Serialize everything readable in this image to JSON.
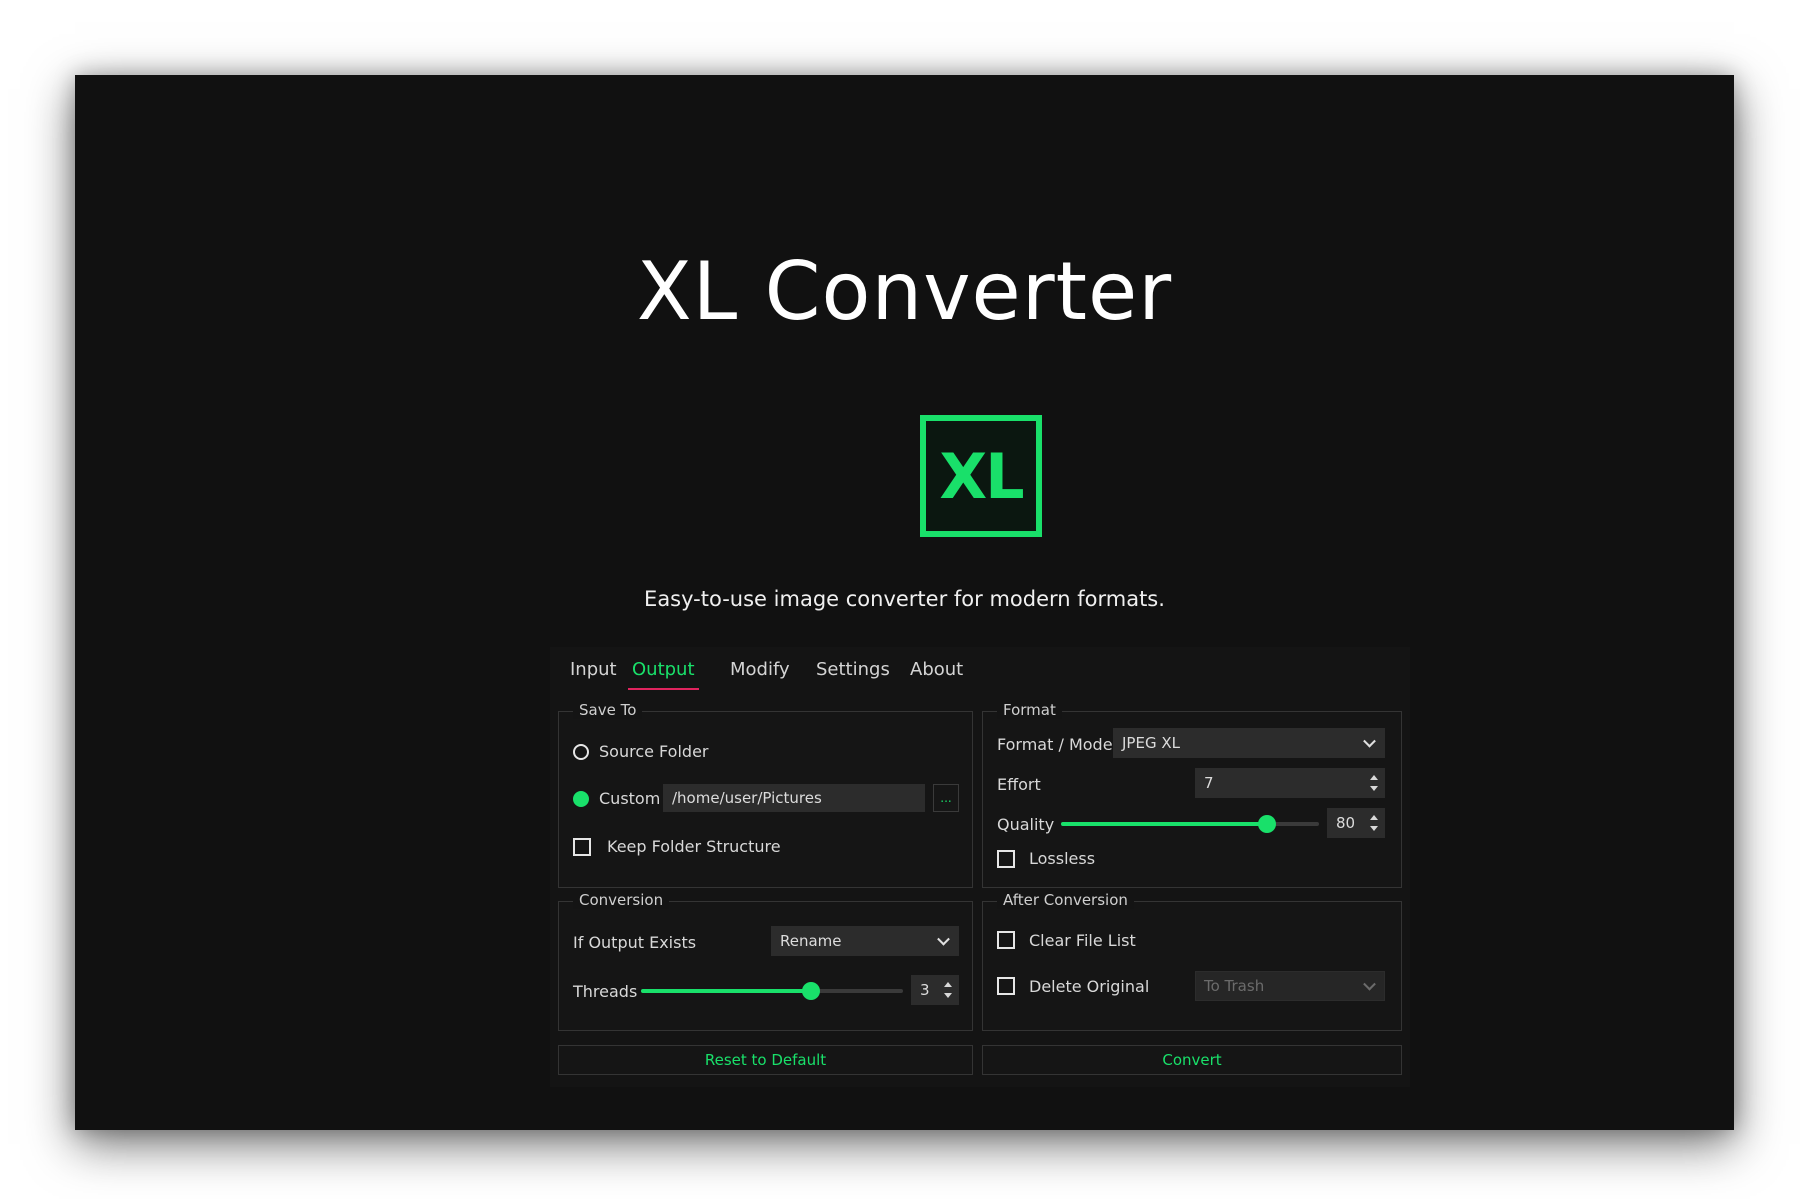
{
  "hero": {
    "title": "XL Converter",
    "logo_text": "XL",
    "tagline": "Easy-to-use image converter for modern formats."
  },
  "tabs": [
    {
      "label": "Input",
      "active": false
    },
    {
      "label": "Output",
      "active": true
    },
    {
      "label": "Modify",
      "active": false
    },
    {
      "label": "Settings",
      "active": false
    },
    {
      "label": "About",
      "active": false
    }
  ],
  "save_to": {
    "title": "Save To",
    "source_folder_label": "Source Folder",
    "source_folder_selected": false,
    "custom_label": "Custom",
    "custom_selected": true,
    "custom_path": "/home/user/Pictures",
    "browse_label": "...",
    "keep_structure_label": "Keep Folder Structure",
    "keep_structure_checked": false
  },
  "format": {
    "title": "Format",
    "mode_label": "Format / Mode",
    "mode_value": "JPEG XL",
    "effort_label": "Effort",
    "effort_value": "7",
    "quality_label": "Quality",
    "quality_value": "80",
    "quality_fraction": 0.8,
    "lossless_label": "Lossless",
    "lossless_checked": false
  },
  "conversion": {
    "title": "Conversion",
    "if_exists_label": "If Output Exists",
    "if_exists_value": "Rename",
    "threads_label": "Threads",
    "threads_value": "3",
    "threads_fraction": 0.65
  },
  "after_conversion": {
    "title": "After Conversion",
    "clear_list_label": "Clear File List",
    "clear_list_checked": false,
    "delete_original_label": "Delete Original",
    "delete_original_checked": false,
    "delete_target_value": "To Trash"
  },
  "actions": {
    "reset_label": "Reset to Default",
    "convert_label": "Convert"
  },
  "colors": {
    "accent": "#19e06a",
    "tab_underline": "#e0245e",
    "background": "#111111"
  }
}
